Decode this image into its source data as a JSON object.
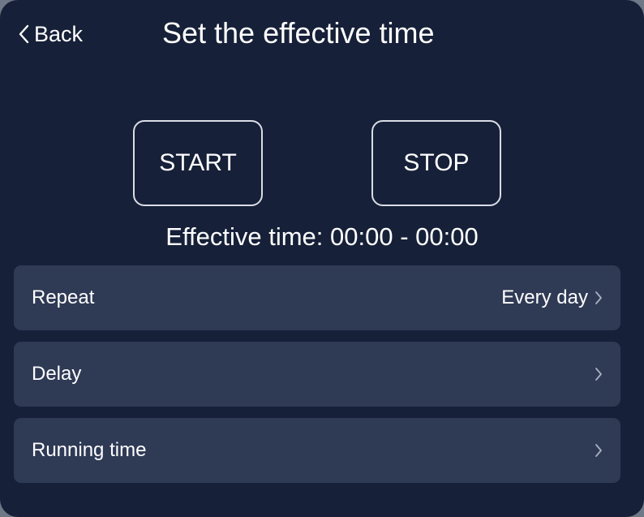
{
  "header": {
    "back_label": "Back",
    "title": "Set the effective time"
  },
  "controls": {
    "start_label": "START",
    "stop_label": "STOP"
  },
  "effective_time": "Effective time: 00:00 - 00:00",
  "settings": [
    {
      "label": "Repeat",
      "value": "Every day"
    },
    {
      "label": "Delay",
      "value": ""
    },
    {
      "label": "Running time",
      "value": ""
    }
  ],
  "icons": {
    "back": "chevron-left-icon",
    "row_arrow": "chevron-right-icon"
  },
  "colors": {
    "background": "#162038",
    "row_background": "#2f3a55",
    "text": "#ffffff",
    "button_border": "#d9dde6"
  }
}
